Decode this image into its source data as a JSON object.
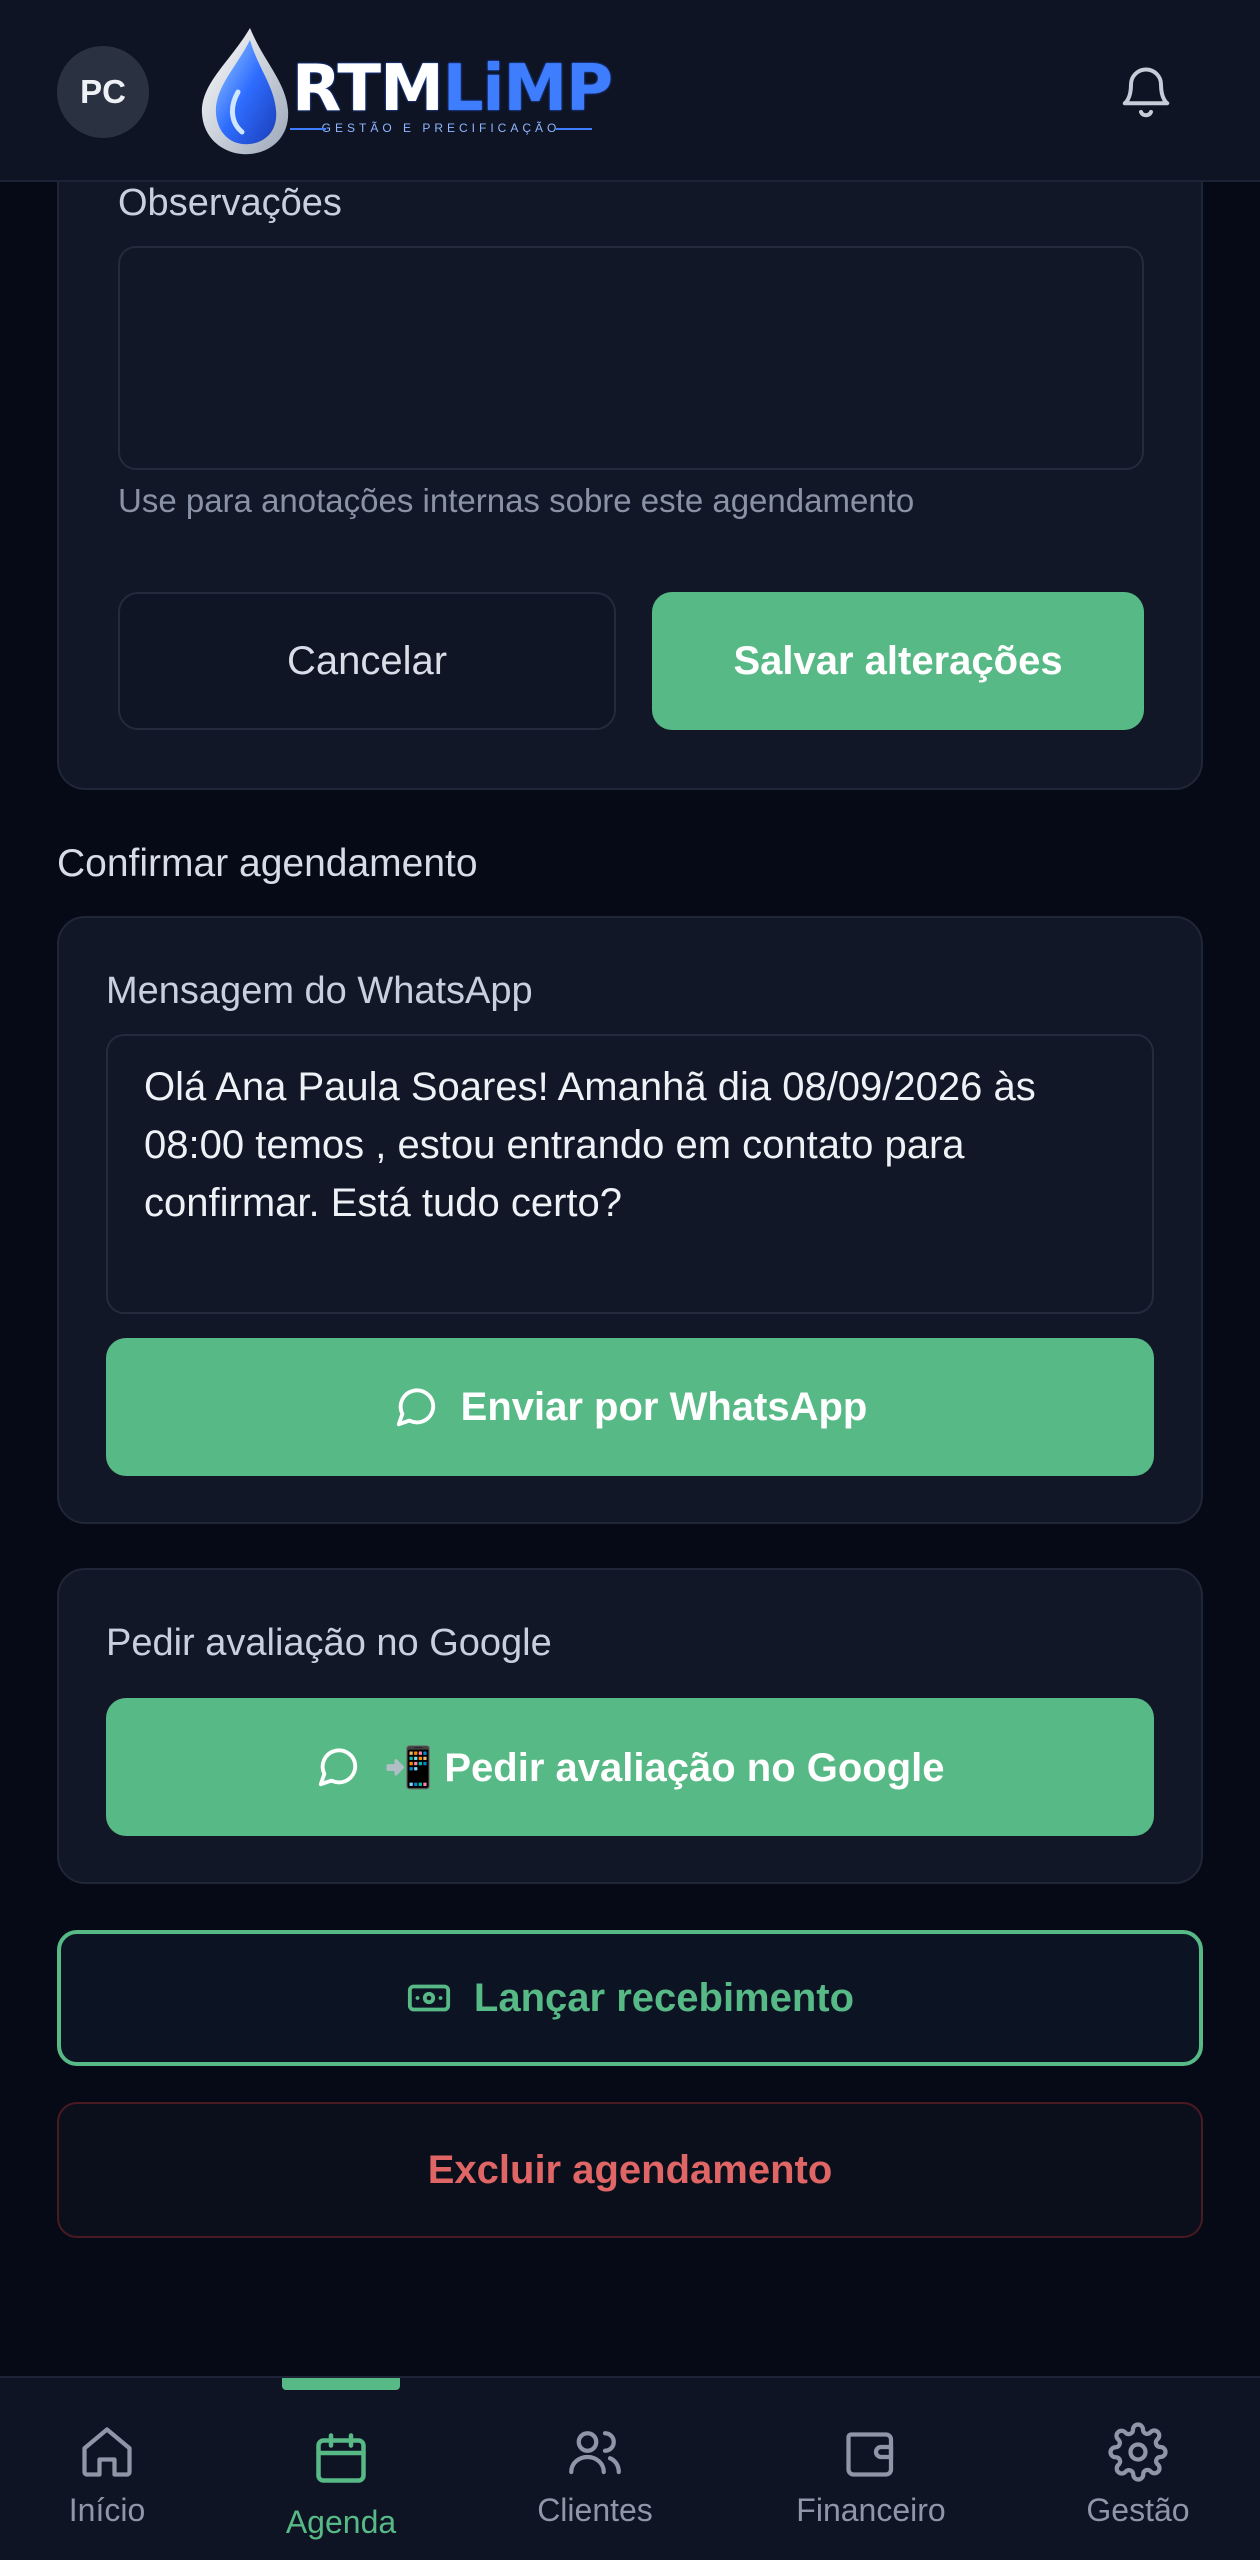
{
  "header": {
    "avatar_initials": "PC",
    "logo_word_main": "RTM",
    "logo_word_accent": "LiMP",
    "logo_subtitle": "GESTÃO E PRECIFICAÇÃO"
  },
  "form": {
    "observacoes_label": "Observações",
    "observacoes_value": "",
    "observacoes_hint": "Use para anotações internas sobre este agendamento",
    "cancel_label": "Cancelar",
    "save_label": "Salvar alterações"
  },
  "confirm": {
    "section_title": "Confirmar agendamento",
    "whatsapp_label": "Mensagem do WhatsApp",
    "whatsapp_message": "Olá Ana Paula Soares! Amanhã dia 08/09/2026 às\n08:00 temos , estou entrando em contato para\nconfirmar. Está tudo certo?",
    "send_whatsapp_label": "Enviar por WhatsApp"
  },
  "review": {
    "label": "Pedir avaliação no Google",
    "button_label": "📲 Pedir avaliação no Google"
  },
  "actions": {
    "receipt_label": "Lançar recebimento",
    "delete_label": "Excluir agendamento"
  },
  "nav": {
    "items": [
      {
        "label": "Início",
        "icon": "home-icon"
      },
      {
        "label": "Agenda",
        "icon": "calendar-icon",
        "active": true
      },
      {
        "label": "Clientes",
        "icon": "users-icon"
      },
      {
        "label": "Financeiro",
        "icon": "wallet-icon"
      },
      {
        "label": "Gestão",
        "icon": "gear-icon"
      }
    ]
  },
  "colors": {
    "background": "#060a16",
    "card": "#111727",
    "accent_green": "#57b985",
    "danger_red": "#e06666",
    "brand_blue": "#3f7dff"
  }
}
